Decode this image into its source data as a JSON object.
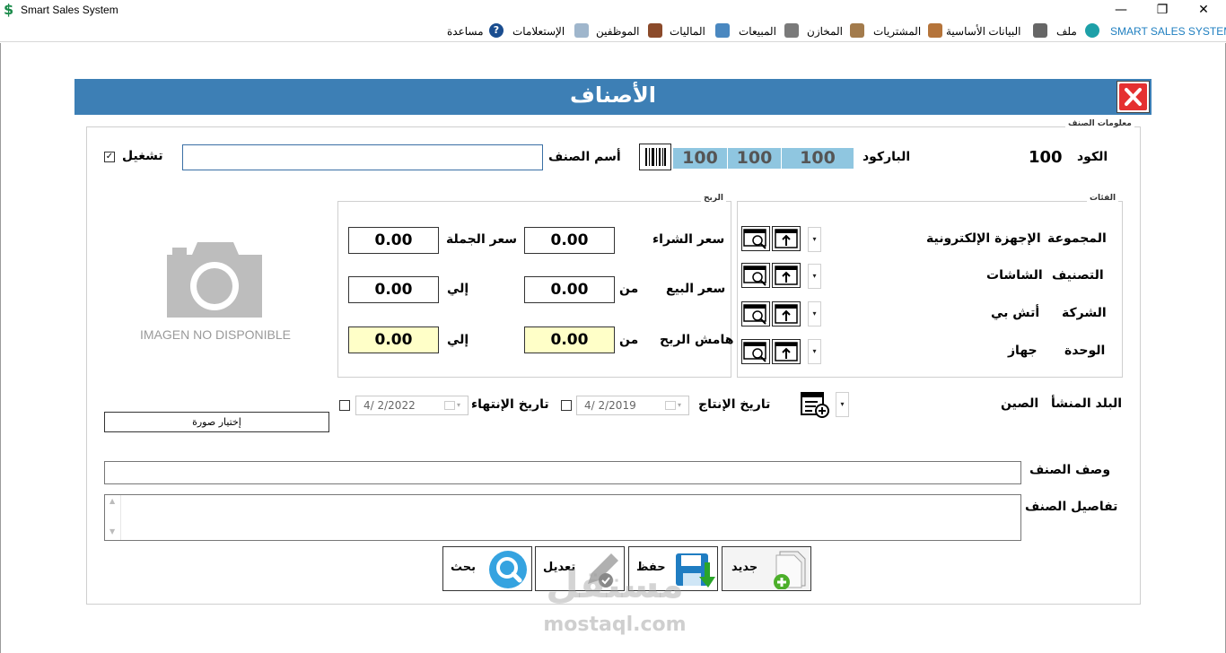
{
  "window": {
    "title": "Smart Sales System",
    "controls": {
      "minimize": "—",
      "restore": "❐",
      "close": "✕"
    }
  },
  "menu": {
    "brand": "SMART SALES SYSTEM",
    "items": [
      {
        "label": "ملف",
        "icon": "gear-icon"
      },
      {
        "label": "البيانات الأساسية",
        "icon": "box-icon"
      },
      {
        "label": "المشتريات",
        "icon": "worker-icon"
      },
      {
        "label": "المخازن",
        "icon": "cart-icon"
      },
      {
        "label": "المبيعات",
        "icon": "users-icon"
      },
      {
        "label": "الماليات",
        "icon": "person-icon"
      },
      {
        "label": "الموظفين",
        "icon": "clipboard-icon"
      },
      {
        "label": "الإستعلامات",
        "icon": "help-icon"
      },
      {
        "label": "مساعدة",
        "icon": "help-icon"
      }
    ]
  },
  "form": {
    "title": "الأصناف",
    "section_info": "معلومات الصنف",
    "code_label": "الكود",
    "code_value": "100",
    "barcode_label": "الباركود",
    "barcode_values": [
      "100",
      "100",
      "100"
    ],
    "item_name_label": "أسم الصنف",
    "item_name_value": "",
    "active_label": "تشغيل",
    "active_checked": true,
    "categories_group": "الفئات",
    "group_label": "المجموعة",
    "group_value": "الإجهزة الإلكترونية",
    "classification_label": "التصنيف",
    "classification_value": "الشاشات",
    "company_label": "الشركة",
    "company_value": "أتش بي",
    "unit_label": "الوحدة",
    "unit_value": "جهاز",
    "profit_group": "الربح",
    "purchase_price_label": "سعر الشراء",
    "purchase_price": "0.00",
    "wholesale_price_label": "سعر الجملة",
    "wholesale_price": "0.00",
    "sale_price_label": "سعر البيع",
    "from_label": "من",
    "to_label": "إلي",
    "sale_price_from": "0.00",
    "sale_price_to": "0.00",
    "profit_margin_label": "هامش الربح",
    "profit_margin_from": "0.00",
    "profit_margin_to": "0.00",
    "image_placeholder": "IMAGEN NO DISPONIBLE",
    "choose_image": "إختيار صورة",
    "origin_label": "البلد المنشأ",
    "origin_value": "الصين",
    "production_date_label": "تاريخ الإنتاج",
    "production_date": "4/  2/2019",
    "expiry_date_label": "تاريخ الإنتهاء",
    "expiry_date": "4/  2/2022",
    "description_label": "وصف الصنف",
    "description_value": "",
    "details_label": "تفاصيل الصنف",
    "details_value": ""
  },
  "buttons": {
    "new": "جديد",
    "save": "حفظ",
    "edit": "تعديل",
    "search": "بحث"
  },
  "watermark": {
    "arabic": "مستقل",
    "latin": "mostaql.com"
  },
  "colors": {
    "header": "#3d7fb5",
    "barcode": "#8fc6e0",
    "highlight": "#ffffc8",
    "close": "#e53030"
  }
}
